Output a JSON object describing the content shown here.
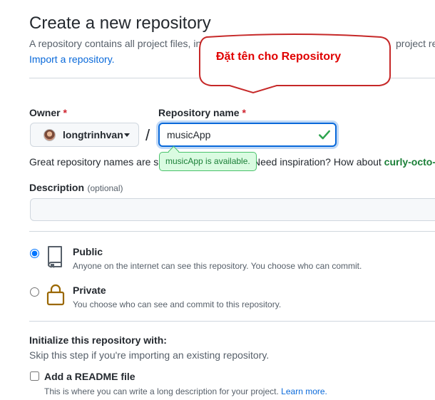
{
  "page": {
    "title": "Create a new repository",
    "subtitle_start": "A repository contains all project files, in",
    "subtitle_end": "project re",
    "import_link": "Import a repository."
  },
  "callout": {
    "text": "Đặt tên cho Repository"
  },
  "owner": {
    "label": "Owner",
    "required": "*",
    "name": "longtrinhvan"
  },
  "repo": {
    "label": "Repository name",
    "required": "*",
    "value": "musicApp",
    "availability": "musicApp is available."
  },
  "separator": "/",
  "hint": {
    "text_start": "Great repository names are sh",
    "text_end": "Need inspiration? How about",
    "suggestion": "curly-octo-f"
  },
  "description": {
    "label": "Description",
    "optional": "(optional)",
    "value": ""
  },
  "visibility": {
    "selected": "public",
    "public": {
      "title": "Public",
      "desc": "Anyone on the internet can see this repository. You choose who can commit."
    },
    "private": {
      "title": "Private",
      "desc": "You choose who can see and commit to this repository."
    }
  },
  "initialize": {
    "heading": "Initialize this repository with:",
    "sub": "Skip this step if you're importing an existing repository.",
    "readme": {
      "label": "Add a README file",
      "desc": "This is where you can write a long description for your project.",
      "link": "Learn more.",
      "checked": false
    }
  },
  "colors": {
    "accent": "#0969da",
    "success": "#1a7f37",
    "callout_red": "#e00000",
    "required_red": "#cf222e"
  },
  "icons": [
    "repo-public-icon",
    "lock-icon",
    "check-icon",
    "caret-down-icon"
  ]
}
